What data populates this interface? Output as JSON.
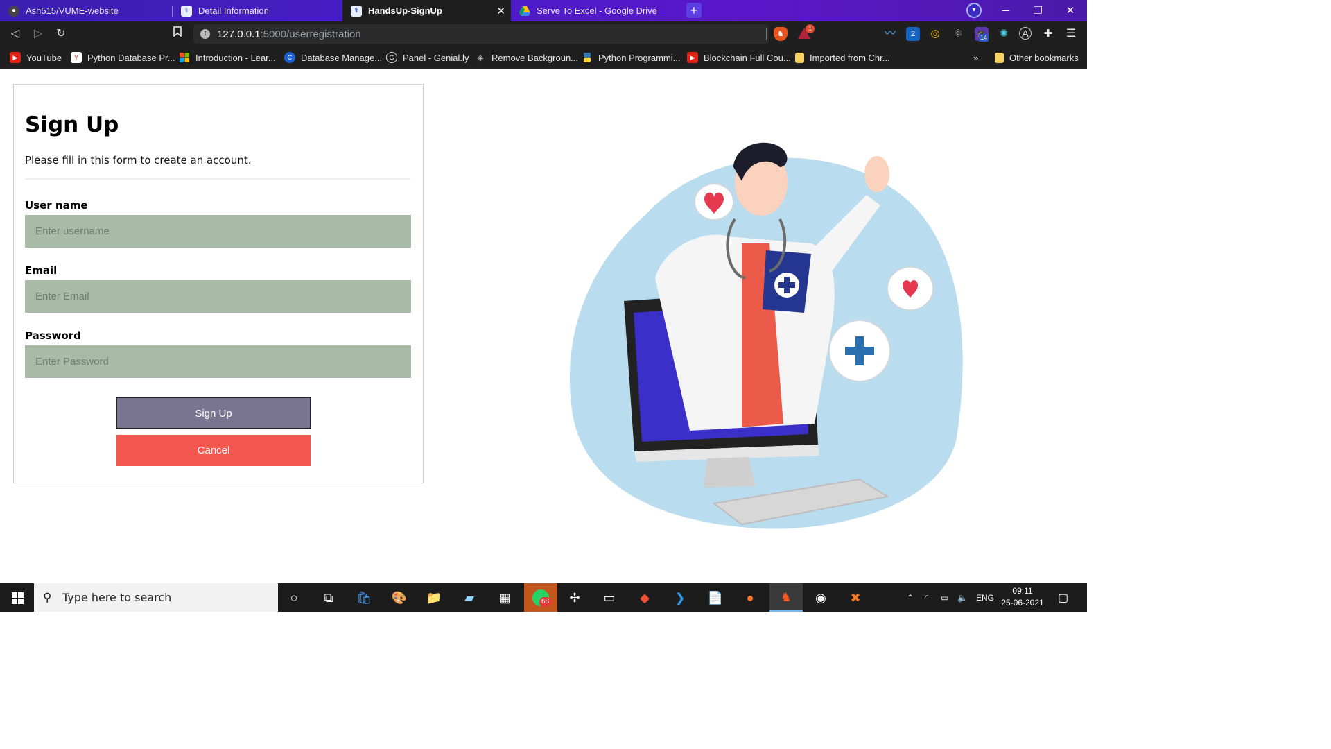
{
  "browser": {
    "tabs": [
      {
        "title": "Ash515/VUME-website",
        "active": false,
        "icon": "github-icon"
      },
      {
        "title": "Detail Information",
        "active": false,
        "icon": "medical-site-icon"
      },
      {
        "title": "HandsUp-SignUp",
        "active": true,
        "icon": "medical-site-icon"
      },
      {
        "title": "Serve To Excel - Google Drive",
        "active": false,
        "icon": "google-drive-icon"
      }
    ],
    "url_host": "127.0.0.1",
    "url_path": ":5000/userregistration",
    "bookmarks": [
      "YouTube",
      "Python Database Pr...",
      "Introduction - Lear...",
      "Database Manage...",
      "Panel - Genial.ly",
      "Remove Backgroun...",
      "Python Programmi...",
      "Blockchain Full Cou...",
      "Imported from Chr..."
    ],
    "more_bookmarks": "»",
    "other_bookmarks": "Other bookmarks",
    "brave_alert_count": "1",
    "ext_badge_2": "2",
    "ext_badge_14": "14"
  },
  "form": {
    "title": "Sign Up",
    "subtitle": "Please fill in this form to create an account.",
    "username_label": "User name",
    "username_placeholder": "Enter username",
    "email_label": "Email",
    "email_placeholder": "Enter Email",
    "password_label": "Password",
    "password_placeholder": "Enter Password",
    "signup_button": "Sign Up",
    "cancel_button": "Cancel"
  },
  "taskbar": {
    "search_placeholder": "Type here to search",
    "whatsapp_badge": "68",
    "language": "ENG",
    "time": "09:11",
    "date": "25-06-2021"
  },
  "colors": {
    "tabstrip": "#4a1cc8",
    "input_bg": "#a7bba7",
    "signup_bg": "#797591",
    "cancel_bg": "#f3574f"
  }
}
